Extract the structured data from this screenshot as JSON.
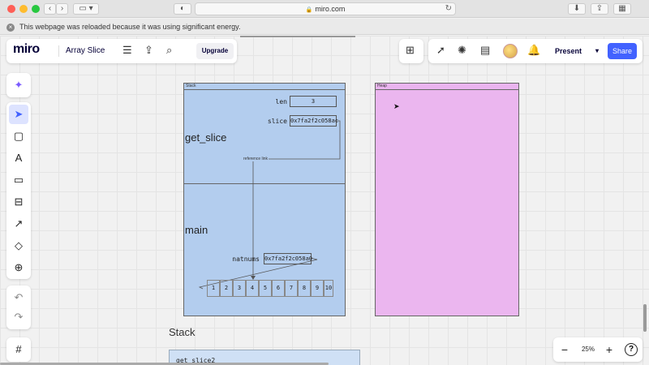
{
  "browser": {
    "url": "miro.com",
    "notice": "This webpage was reloaded because it was using significant energy."
  },
  "miro": {
    "logo": "miro",
    "board_title": "Array Slice",
    "upgrade_label": "Upgrade",
    "present_label": "Present",
    "share_label": "Share",
    "zoom": "25%",
    "help": "?"
  },
  "diagram": {
    "stack_frame_title": "Stack",
    "heap_frame_title": "Heap",
    "get_slice_label": "get_slice",
    "main_label": "main",
    "len_name": "len",
    "len_value": "3",
    "slice_name": "slice",
    "slice_value": "0x7fa2f2c058ac",
    "link_label": "reference link",
    "natnums_name": "natnums",
    "natnums_value": "0x7fa2f2c058a0",
    "cells": [
      "1",
      "2",
      "3",
      "4",
      "5",
      "6",
      "7",
      "8",
      "9",
      "10"
    ],
    "stack2_label": "Stack",
    "get_slice2_label": "get_slice2"
  },
  "colors": {
    "stack_fill": "#b3cdee",
    "heap_fill": "#ebb6ef",
    "accent": "#4262ff"
  }
}
